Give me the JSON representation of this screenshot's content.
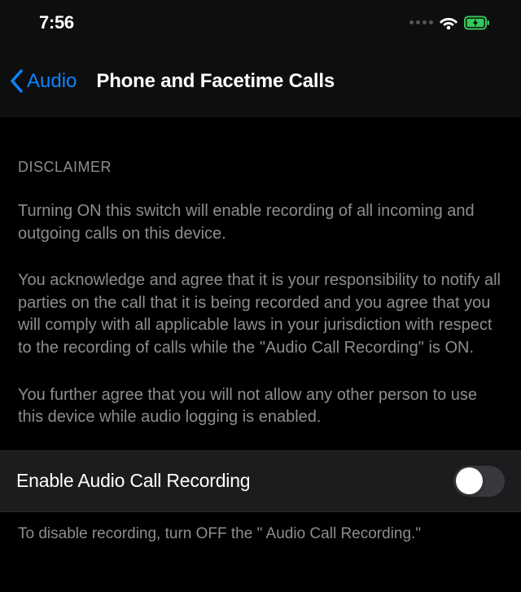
{
  "statusBar": {
    "time": "7:56"
  },
  "navBar": {
    "backLabel": "Audio",
    "title": "Phone and Facetime Calls"
  },
  "disclaimer": {
    "header": "DISCLAIMER",
    "para1": "Turning ON this switch will enable recording of all incoming and outgoing calls on this device.",
    "para2": "You acknowledge and agree that it is your responsibility to notify all parties on the call that it is being recorded and you agree that you will comply with all applicable laws in your jurisdiction with respect to the recording of calls while the \"Audio Call Recording\" is ON.",
    "para3": "You further agree that you will not allow any other person to use this device while audio logging is enabled."
  },
  "setting": {
    "label": "Enable Audio Call Recording",
    "enabled": false
  },
  "footer": {
    "text": "To disable recording, turn OFF the \" Audio Call Recording.\""
  }
}
